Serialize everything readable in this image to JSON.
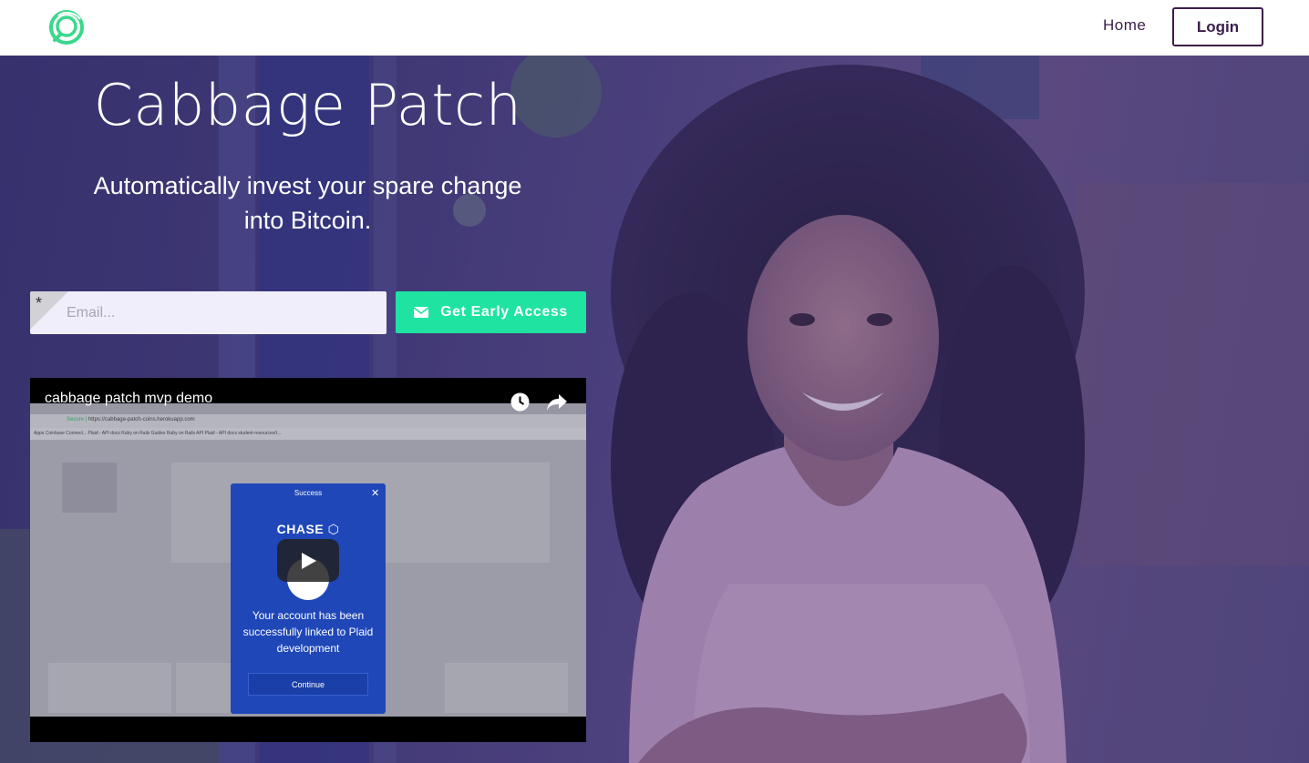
{
  "navbar": {
    "logo_icon": "cabbage-logo-icon",
    "home_label": "Home",
    "login_label": "Login",
    "brand_color": "#3a1d4a",
    "logo_color": "#3ad88a"
  },
  "hero": {
    "title": "Cabbage Patch",
    "subtitle_line1": "Automatically invest your spare change",
    "subtitle_line2": "into Bitcoin.",
    "email_placeholder": "Email...",
    "required_marker": "*",
    "cta_label": "Get Early Access",
    "cta_icon": "envelope-icon",
    "cta_color": "#1fe3a1"
  },
  "video": {
    "title": "cabbage patch mvp demo",
    "watch_later_icon": "clock-icon",
    "share_icon": "share-icon",
    "play_icon": "play-icon",
    "browser": {
      "secure_label": "Secure",
      "url": "https://cabbage-patch-coins.herokuapp.com",
      "bookmarks": "Apps   Coinbase Connect...   Plaid - API docs   Ruby on Rails Guides   Ruby on Rails API   Plaid - API docs   student-resources/t..."
    },
    "modal": {
      "header": "Success",
      "bank": "CHASE",
      "message": "Your account has been successfully linked to Plaid development",
      "button": "Continue"
    }
  }
}
